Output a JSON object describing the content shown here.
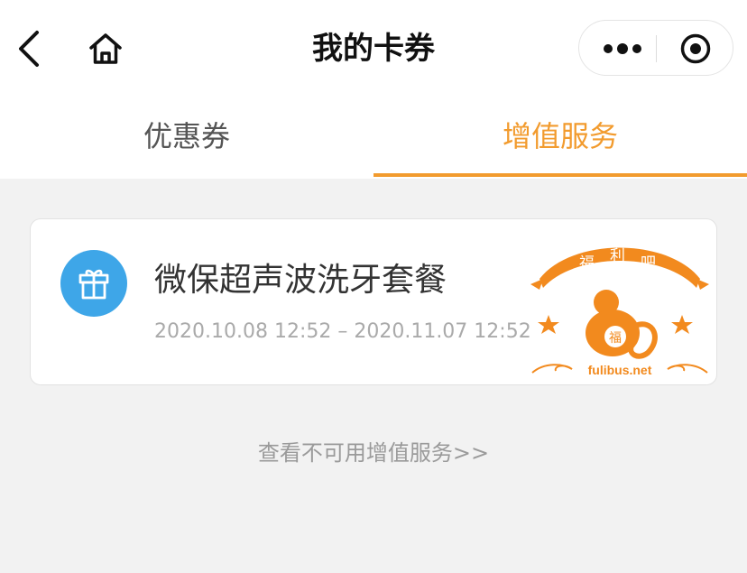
{
  "header": {
    "title": "我的卡券",
    "back_icon": "chevron-left-icon",
    "home_icon": "home-icon",
    "more_icon": "more-dots-icon",
    "close_icon": "target-close-icon"
  },
  "tabs": [
    {
      "label": "优惠券",
      "active": false
    },
    {
      "label": "增值服务",
      "active": true
    }
  ],
  "colors": {
    "accent": "#f29b2e",
    "gift_badge": "#3ea6e8",
    "watermark_orange": "#f28a1e"
  },
  "service_card": {
    "icon": "gift-icon",
    "title": "微保超声波洗牙套餐",
    "date_range": "2020.10.08 12:52 – 2020.11.07 12:52",
    "watermark": {
      "banner_text": "福 利 吧",
      "badge_char": "福",
      "site": "fulibus.net"
    }
  },
  "footer_link": "查看不可用增值服务>>"
}
